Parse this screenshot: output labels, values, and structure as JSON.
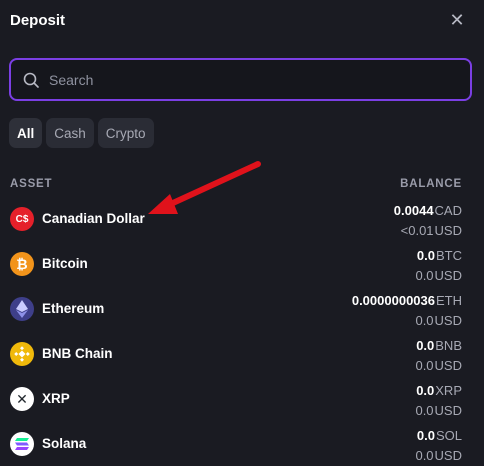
{
  "header": {
    "title": "Deposit",
    "close_icon": "close-icon"
  },
  "search": {
    "placeholder": "Search",
    "value": "",
    "icon": "search-icon"
  },
  "filters": [
    {
      "label": "All",
      "active": true
    },
    {
      "label": "Cash",
      "active": false
    },
    {
      "label": "Crypto",
      "active": false
    }
  ],
  "columns": {
    "asset": "ASSET",
    "balance": "BALANCE"
  },
  "assets": [
    {
      "name": "Canadian Dollar",
      "icon": "canadian-dollar-icon",
      "icon_text": "C$",
      "color": "#e5202a",
      "amount": "0.0044",
      "currency": "CAD",
      "usd_amount": "<0.01",
      "usd_label": "USD"
    },
    {
      "name": "Bitcoin",
      "icon": "bitcoin-icon",
      "icon_text": "₿",
      "color": "#f2941b",
      "amount": "0.0",
      "currency": "BTC",
      "usd_amount": "0.0",
      "usd_label": "USD"
    },
    {
      "name": "Ethereum",
      "icon": "ethereum-icon",
      "icon_text": "",
      "color": "#3e3f8a",
      "amount": "0.0000000036",
      "currency": "ETH",
      "usd_amount": "0.0",
      "usd_label": "USD"
    },
    {
      "name": "BNB Chain",
      "icon": "bnb-chain-icon",
      "icon_text": "",
      "color": "#f0b90b",
      "amount": "0.0",
      "currency": "BNB",
      "usd_amount": "0.0",
      "usd_label": "USD"
    },
    {
      "name": "XRP",
      "icon": "xrp-icon",
      "icon_text": "✕",
      "color": "#ffffff",
      "amount": "0.0",
      "currency": "XRP",
      "usd_amount": "0.0",
      "usd_label": "USD"
    },
    {
      "name": "Solana",
      "icon": "solana-icon",
      "icon_text": "",
      "color": "#ffffff",
      "amount": "0.0",
      "currency": "SOL",
      "usd_amount": "0.0",
      "usd_label": "USD"
    }
  ],
  "annotation": {
    "icon": "red-arrow-annotation",
    "color": "#e0121b"
  }
}
